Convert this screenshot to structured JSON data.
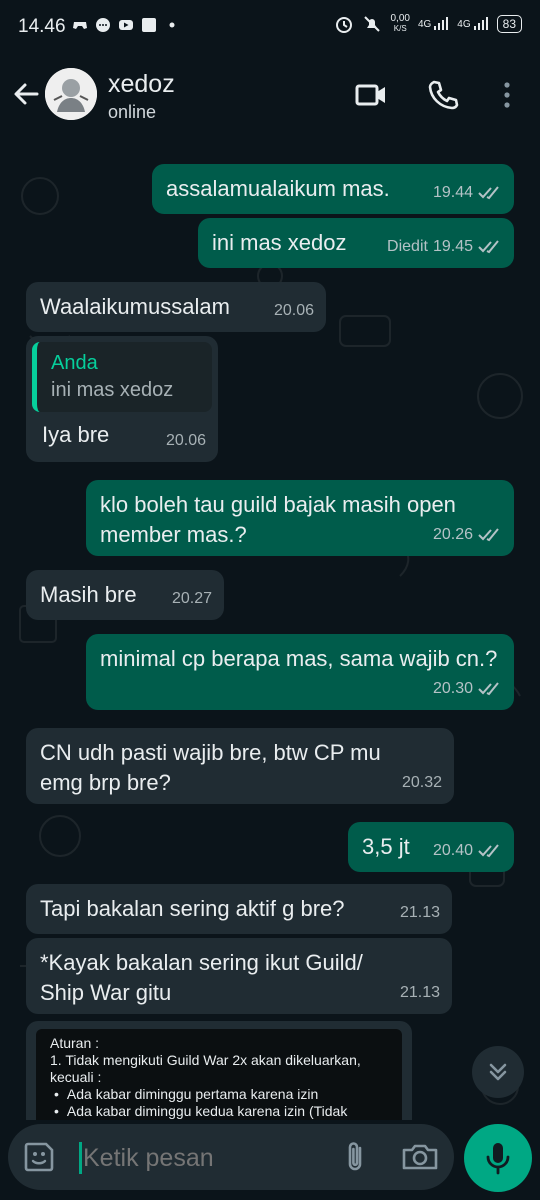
{
  "status_bar": {
    "time": "14.46",
    "net_speed": "0,00",
    "net_unit": "K/S",
    "sim1": "4G",
    "sim2": "4G",
    "battery": "83"
  },
  "header": {
    "contact_name": "xedoz",
    "status": "online"
  },
  "messages": [
    {
      "dir": "out",
      "text": "assalamualaikum mas.",
      "time": "19.44",
      "edited": ""
    },
    {
      "dir": "out",
      "text": "ini mas xedoz",
      "time": "19.45",
      "edited": "Diedit"
    },
    {
      "dir": "in",
      "text": "Waalaikumussalam",
      "time": "20.06"
    },
    {
      "dir": "in",
      "quote_name": "Anda",
      "quote_text": "ini mas xedoz",
      "text": "Iya bre",
      "time": "20.06"
    },
    {
      "dir": "out",
      "text": "klo boleh tau guild bajak masih open member mas.?",
      "time": "20.26"
    },
    {
      "dir": "in",
      "text": "Masih bre",
      "time": "20.27"
    },
    {
      "dir": "out",
      "text": "minimal cp berapa mas, sama wajib cn.?",
      "time": "20.30"
    },
    {
      "dir": "in",
      "text": "CN udh pasti wajib bre, btw CP mu emg brp bre?",
      "time": "20.32"
    },
    {
      "dir": "out",
      "text": "3,5 jt",
      "time": "20.40"
    },
    {
      "dir": "in",
      "text": "Tapi bakalan sering aktif g bre?",
      "time": "21.13"
    },
    {
      "dir": "in",
      "text": "*Kayak bakalan sering ikut Guild/ Ship War gitu",
      "time": "21.13"
    }
  ],
  "rules_card": {
    "title": "Aturan :",
    "line1": "1. Tidak mengikuti Guild War 2x akan dikeluarkan,",
    "line2": "kecuali :",
    "bullet1": "Ada kabar diminggu pertama karena izin",
    "bullet2": "Ada kabar diminggu kedua karena izin (Tidak"
  },
  "composer": {
    "placeholder": "Ketik pesan"
  },
  "icons": {
    "back": "arrow-left-icon",
    "video": "video-call-icon",
    "call": "phone-icon",
    "menu": "more-vert-icon",
    "emoji": "sticker-icon",
    "attach": "paperclip-icon",
    "camera": "camera-icon",
    "mic": "mic-icon",
    "scroll": "chevrons-down-icon"
  },
  "colors": {
    "outgoing": "#005c4b",
    "incoming": "#202c33",
    "accent": "#00a884",
    "background": "#0b141a"
  }
}
